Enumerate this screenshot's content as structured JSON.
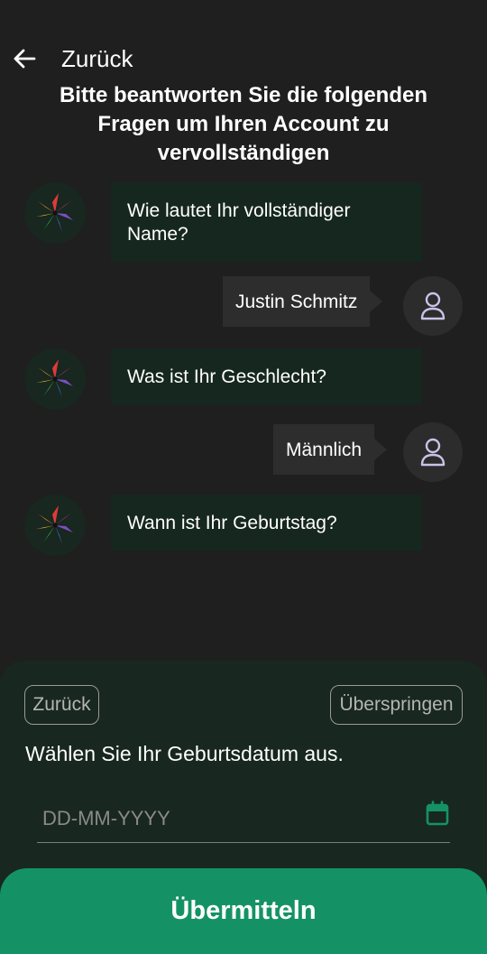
{
  "header": {
    "back_label": "Zurück",
    "title": "Bitte beantworten Sie die folgenden Fragen um Ihren Account zu vervollständigen"
  },
  "chat": {
    "q1": "Wie lautet Ihr vollständiger Name?",
    "a1": "Justin Schmitz",
    "q2": "Was ist Ihr Geschlecht?",
    "a2": "Männlich",
    "q3": "Wann ist Ihr Geburtstag?"
  },
  "panel": {
    "back_button": "Zurück",
    "skip_button": "Überspringen",
    "prompt": "Wählen Sie Ihr Geburtsdatum aus.",
    "date_placeholder": "DD-MM-YYYY"
  },
  "submit_label": "Übermitteln",
  "colors": {
    "background": "#1f1f1f",
    "bot_bubble": "#16271f",
    "user_bubble": "#2d2d2d",
    "accent": "#149266"
  },
  "icons": {
    "back": "arrow-left-icon",
    "bot": "pinwheel-logo-icon",
    "user": "user-icon",
    "calendar": "calendar-icon"
  }
}
